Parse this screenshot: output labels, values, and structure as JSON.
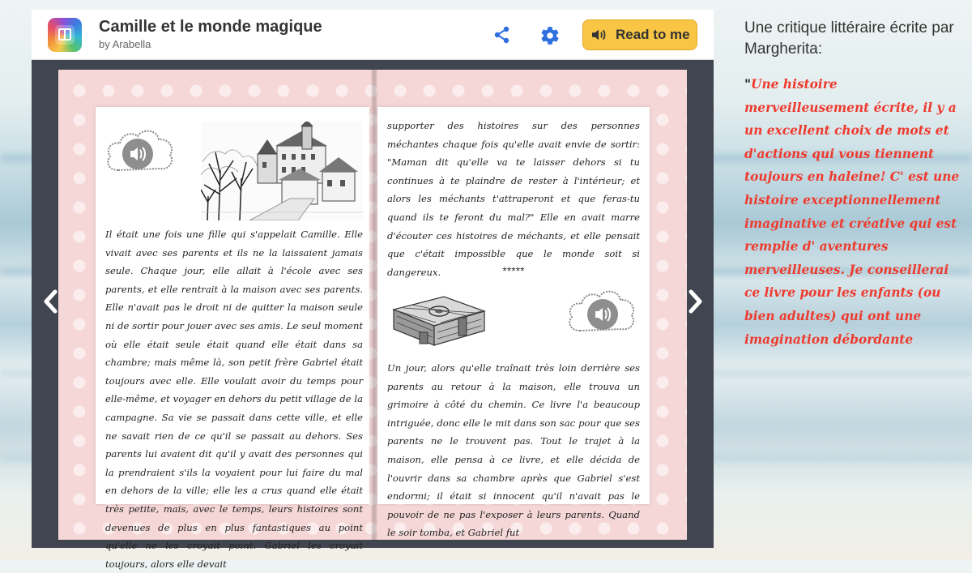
{
  "app": {
    "title": "Camille et le monde magique",
    "author": "by Arabella",
    "read_button_label": "Read to me",
    "icons": {
      "logo": "book-creator-logo",
      "share": "share-icon",
      "settings": "gear-icon",
      "speaker": "speaker-icon"
    }
  },
  "colors": {
    "read_button": "#f8c545",
    "accent_blue": "#2f6fe0",
    "frame": "#414550",
    "review_text": "#ee3b2f",
    "page_background": "#f6d7d7"
  },
  "book": {
    "left_page": {
      "text": "Il était une fois une fille qui s'appelait Camille. Elle vivait avec ses parents et ils ne la laissaient jamais seule. Chaque jour, elle allait à l'école avec ses parents, et elle rentrait à la maison avec ses parents. Elle n'avait pas le droit ni de quitter la maison seule ni de sortir pour jouer avec ses amis. Le seul moment où elle était seule était quand elle était dans sa chambre; mais même là, son petit frère Gabriel était toujours avec elle. Elle voulait avoir du temps pour elle-même, et voyager en dehors du petit village de la campagne. Sa vie se passait dans cette ville, et elle ne savait rien de ce qu'il se passait au dehors. Ses parents lui avaient dit qu'il y avait des personnes qui la prendraient s'ils la voyaient pour lui faire du mal en dehors de la ville; elle les a crus quand elle était très petite, mais, avec le temps, leurs histoires sont devenues de plus en plus fantastiques au point qu'elle ne les croyait point. Gabriel les croyait toujours, alors elle devait",
      "illustration": "village-castle-sketch",
      "audio_icon": "cloud-speaker-icon"
    },
    "right_page": {
      "text_top": "supporter des histoires sur des personnes méchantes chaque fois qu'elle avait envie de sortir: \"Maman dit qu'elle va te laisser dehors si tu continues à te plaindre de rester à l'intérieur; et alors les méchants t'attraperont et que feras-tu quand ils te feront du mal?\" Elle en avait marre d'écouter ces histoires de méchants, et elle pensait que c'était impossible que le monde soit si dangereux.",
      "separator": "*****",
      "text_bottom": "Un jour, alors qu'elle traînait très loin derrière ses parents au retour à la maison, elle trouva un grimoire à côté du chemin. Ce livre l'a beaucoup intriguée, donc elle le mit dans son sac pour que ses parents ne le trouvent pas. Tout le trajet à la maison, elle pensa à ce livre, et elle décida de l'ouvrir dans sa chambre après que Gabriel s'est endormi; il était si innocent qu'il n'avait pas le pouvoir de ne pas l'exposer à leurs parents. Quand le soir tomba, et Gabriel fut",
      "illustration": "grimoire-sketch",
      "audio_icon": "cloud-speaker-icon"
    },
    "nav": {
      "prev_icon": "chevron-left-icon",
      "next_icon": "chevron-right-icon"
    }
  },
  "review": {
    "heading": "Une critique littéraire écrite par Margherita:",
    "quote_mark": "\"",
    "body": "Une histoire merveilleusement écrite, il y a un excellent choix de mots et d'actions qui vous tiennent toujours en haleine! C' est une histoire exceptionnellement imaginative et créative qui est remplie d' aventures merveilleuses. Je conseillerai ce livre pour les enfants (ou bien adultes) qui ont une imagination débordante"
  }
}
